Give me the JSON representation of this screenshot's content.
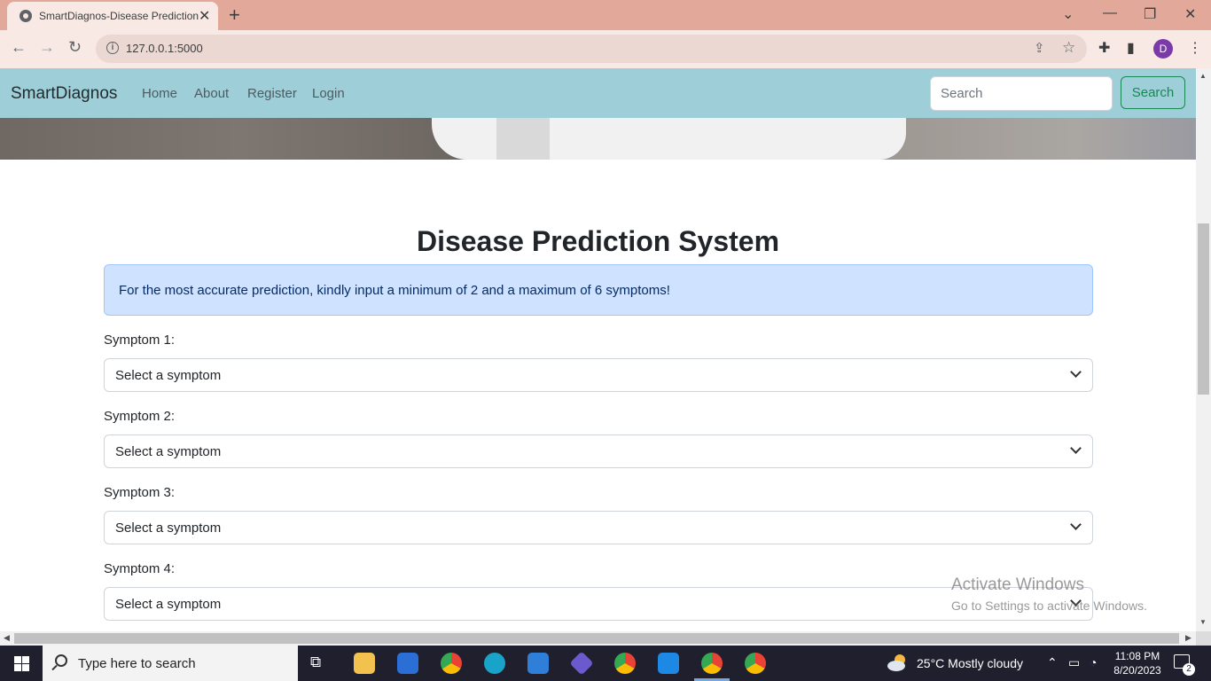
{
  "browser": {
    "tab_title": "SmartDiagnos-Disease Prediction",
    "url": "127.0.0.1:5000",
    "profile_initial": "D"
  },
  "navbar": {
    "brand": "SmartDiagnos",
    "links": [
      "Home",
      "About",
      "Register",
      "Login"
    ],
    "search_placeholder": "Search",
    "search_button": "Search"
  },
  "main": {
    "heading": "Disease Prediction System",
    "alert": "For the most accurate prediction, kindly input a minimum of 2 and a maximum of 6 symptoms!",
    "symptoms": [
      {
        "label": "Symptom 1:",
        "selected": "Select a symptom"
      },
      {
        "label": "Symptom 2:",
        "selected": "Select a symptom"
      },
      {
        "label": "Symptom 3:",
        "selected": "Select a symptom"
      },
      {
        "label": "Symptom 4:",
        "selected": "Select a symptom"
      }
    ]
  },
  "watermark": {
    "line1": "Activate Windows",
    "line2": "Go to Settings to activate Windows."
  },
  "taskbar": {
    "search_text": "Type here to search",
    "weather": "25°C  Mostly cloudy",
    "time": "11:08 PM",
    "date": "8/20/2023",
    "notification_count": "2"
  },
  "colors": {
    "navbar_bg": "#9ecfd9",
    "alert_bg": "#cfe2ff",
    "search_button": "#198754",
    "chrome_titlebar": "#e2a99a"
  }
}
